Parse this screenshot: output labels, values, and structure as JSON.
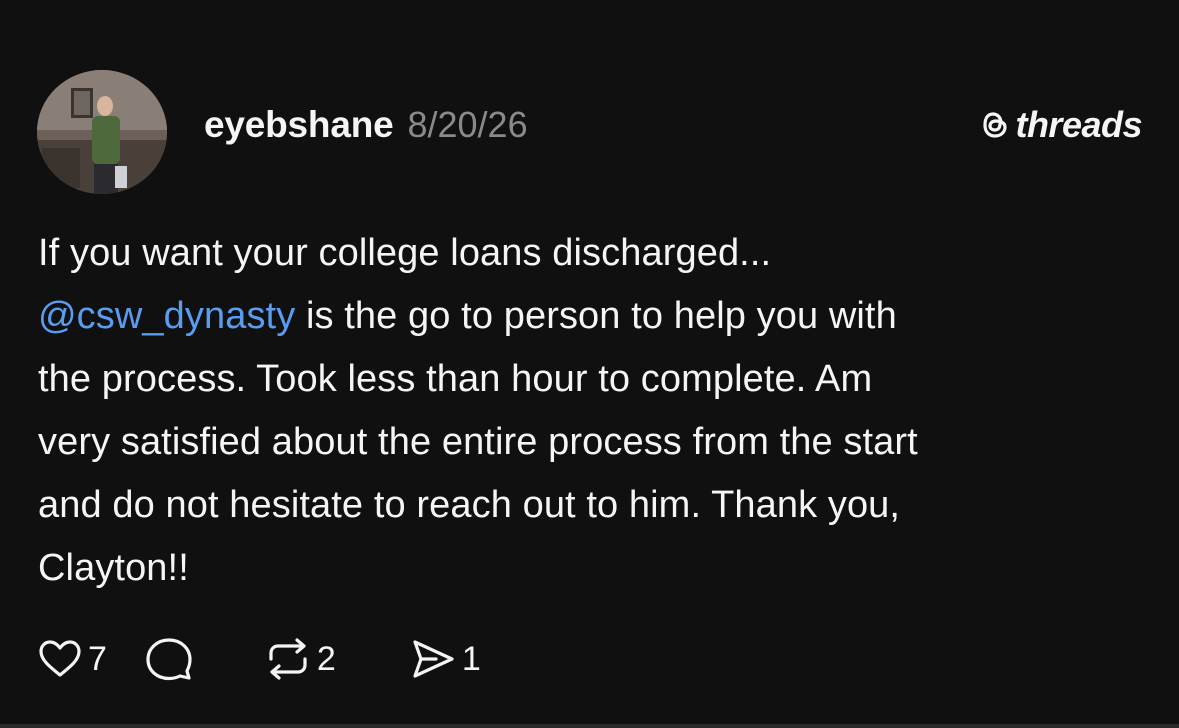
{
  "post": {
    "author": "eyebshane",
    "date": "8/20/26",
    "brand": "threads",
    "body_lines": [
      {
        "mention": "",
        "text": "If you want your college loans discharged..."
      },
      {
        "mention": "@csw_dynasty",
        "text": " is the go to person to help you with"
      },
      {
        "mention": "",
        "text": "the process. Took less than hour to complete. Am"
      },
      {
        "mention": "",
        "text": "very satisfied about the entire process from the start"
      },
      {
        "mention": "",
        "text": "and do not hesitate to reach out to him. Thank you,"
      },
      {
        "mention": "",
        "text": "Clayton!!"
      }
    ],
    "actions": {
      "likes": "7",
      "reposts": "2",
      "shares": "1"
    }
  },
  "colors": {
    "background": "#101010",
    "text": "#f3f5f7",
    "muted": "#8a8a8a",
    "mention": "#5a9cf0"
  },
  "icons": [
    "heart-icon",
    "comment-icon",
    "repost-icon",
    "share-icon",
    "threads-logo-icon"
  ]
}
